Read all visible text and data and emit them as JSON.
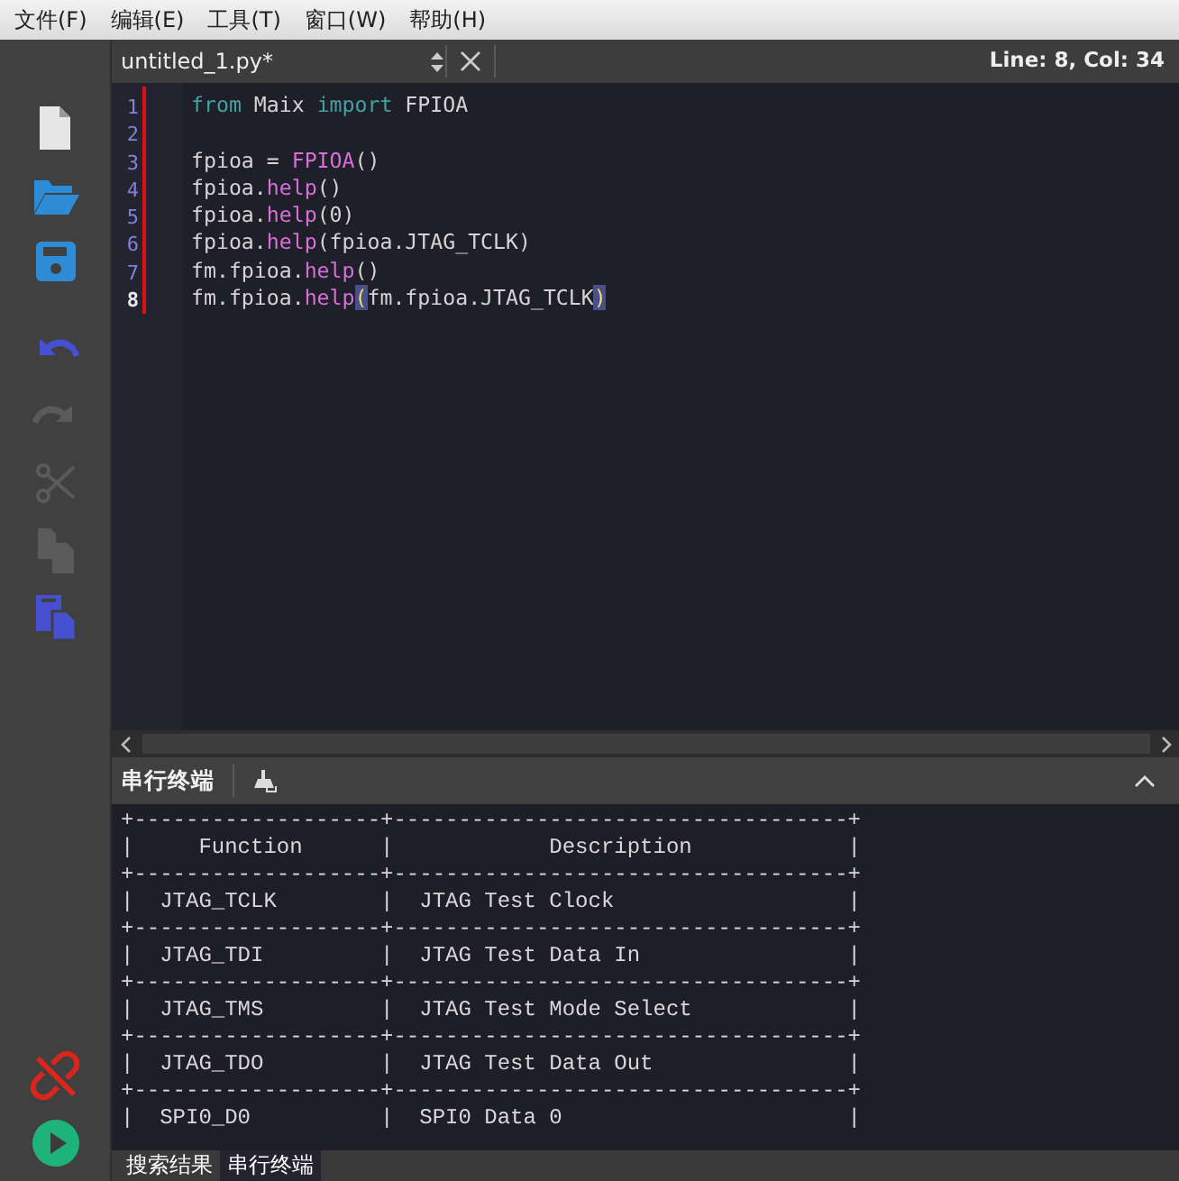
{
  "menu": [
    "文件(F)",
    "编辑(E)",
    "工具(T)",
    "窗口(W)",
    "帮助(H)"
  ],
  "toolbar": [
    {
      "kind": "new",
      "disabled": false
    },
    {
      "kind": "open",
      "disabled": false
    },
    {
      "kind": "save",
      "disabled": false
    },
    {
      "kind": "undo",
      "disabled": false
    },
    {
      "kind": "redo",
      "disabled": true
    },
    {
      "kind": "cut",
      "disabled": true
    },
    {
      "kind": "copy",
      "disabled": true
    },
    {
      "kind": "paste",
      "disabled": false
    }
  ],
  "toolbar_bottom": [
    {
      "kind": "disconnect"
    },
    {
      "kind": "run"
    }
  ],
  "editor": {
    "file_name": "untitled_1.py*",
    "position": "Line: 8, Col: 34",
    "lines": [
      {
        "number": "1",
        "current": false,
        "tokens": [
          {
            "kind": "keyword",
            "text": "from"
          },
          {
            "kind": "plain",
            "text": " Maix "
          },
          {
            "kind": "keyword",
            "text": "import"
          },
          {
            "kind": "plain",
            "text": " FPIOA"
          }
        ]
      },
      {
        "number": "2",
        "current": false
      },
      {
        "number": "3",
        "current": false,
        "tokens": [
          {
            "kind": "plain",
            "text": "fpioa = "
          },
          {
            "kind": "call",
            "text": "FPIOA"
          },
          {
            "kind": "plain",
            "text": "()"
          }
        ]
      },
      {
        "number": "4",
        "current": false,
        "tokens": [
          {
            "kind": "plain",
            "text": "fpioa."
          },
          {
            "kind": "call",
            "text": "help"
          },
          {
            "kind": "plain",
            "text": "()"
          }
        ]
      },
      {
        "number": "5",
        "current": false,
        "tokens": [
          {
            "kind": "plain",
            "text": "fpioa."
          },
          {
            "kind": "call",
            "text": "help"
          },
          {
            "kind": "plain",
            "text": "(0)"
          }
        ]
      },
      {
        "number": "6",
        "current": false,
        "tokens": [
          {
            "kind": "plain",
            "text": "fpioa."
          },
          {
            "kind": "call",
            "text": "help"
          },
          {
            "kind": "plain",
            "text": "(fpioa.JTAG_TCLK)"
          }
        ]
      },
      {
        "number": "7",
        "current": false,
        "tokens": [
          {
            "kind": "plain",
            "text": "fm.fpioa."
          },
          {
            "kind": "call",
            "text": "help"
          },
          {
            "kind": "plain",
            "text": "()"
          }
        ]
      },
      {
        "number": "8",
        "current": true,
        "tokens": [
          {
            "kind": "plain",
            "text": "fm.fpioa."
          },
          {
            "kind": "call",
            "text": "help"
          },
          {
            "kind": "match",
            "text": "("
          },
          {
            "kind": "plain",
            "text": "fm.fpioa.JTAG_TCLK"
          },
          {
            "kind": "match",
            "text": ")"
          }
        ]
      }
    ]
  },
  "terminal": {
    "title": "串行终端",
    "lines": [
      "+-------------------+-----------------------------------+",
      "|     Function      |            Description            |",
      "+-------------------+-----------------------------------+",
      "|  JTAG_TCLK        |  JTAG Test Clock                  |",
      "+-------------------+-----------------------------------+",
      "|  JTAG_TDI         |  JTAG Test Data In                |",
      "+-------------------+-----------------------------------+",
      "|  JTAG_TMS         |  JTAG Test Mode Select            |",
      "+-------------------+-----------------------------------+",
      "|  JTAG_TDO         |  JTAG Test Data Out               |",
      "+-------------------+-----------------------------------+",
      "|  SPI0_D0          |  SPI0 Data 0                      |"
    ]
  },
  "bottom_tabs": [
    {
      "label": "搜索结果",
      "selected": false
    },
    {
      "label": "串行终端",
      "selected": true
    }
  ]
}
